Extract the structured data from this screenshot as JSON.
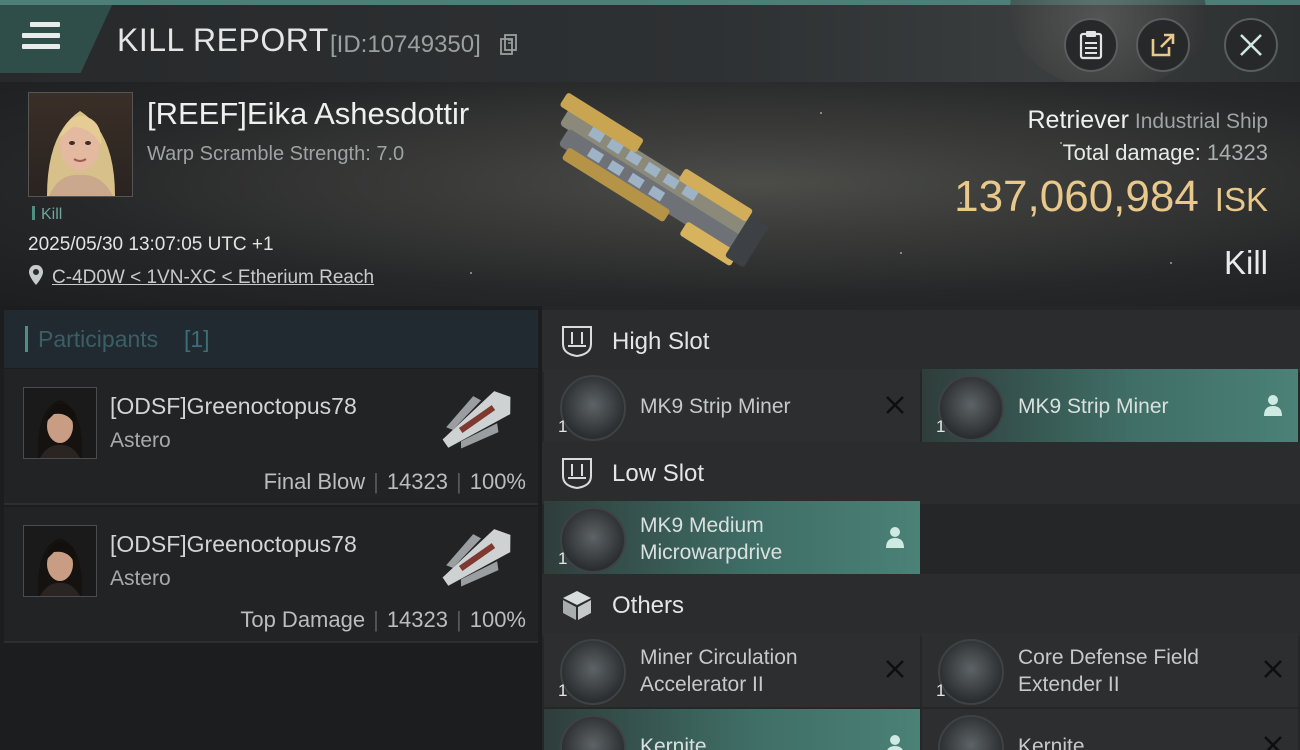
{
  "header": {
    "title": "KILL REPORT",
    "report_id": "[ID:10749350]"
  },
  "victim": {
    "name": "[REEF]Eika Ashesdottir",
    "warp_scramble": "Warp Scramble Strength: 7.0",
    "tag": "Kill",
    "datetime": "2025/05/30 13:07:05 UTC +1",
    "location": "C-4D0W < 1VN-XC < Etherium Reach"
  },
  "ship": {
    "name": "Retriever",
    "class": "Industrial Ship",
    "total_damage_label": "Total damage:",
    "total_damage": "14323",
    "value": "137,060,984",
    "currency": "ISK",
    "result": "Kill"
  },
  "participants": {
    "title": "Participants",
    "count": "[1]",
    "rows": [
      {
        "name": "[ODSF]Greenoctopus78",
        "ship": "Astero",
        "role": "Final Blow",
        "damage": "14323",
        "percent": "100%"
      },
      {
        "name": "[ODSF]Greenoctopus78",
        "ship": "Astero",
        "role": "Top Damage",
        "damage": "14323",
        "percent": "100%"
      }
    ]
  },
  "fitting": {
    "high": {
      "label": "High Slot",
      "modules": [
        {
          "name": "MK9 Strip Miner",
          "qty": "1",
          "state": "destroyed"
        },
        {
          "name": "MK9 Strip Miner",
          "qty": "1",
          "state": "dropped"
        }
      ]
    },
    "low": {
      "label": "Low Slot",
      "modules": [
        {
          "name_line1": "MK9 Medium",
          "name_line2": "Microwarpdrive",
          "qty": "1",
          "state": "dropped"
        }
      ]
    },
    "others": {
      "label": "Others",
      "modules": [
        {
          "name_line1": "Miner Circulation",
          "name_line2": "Accelerator II",
          "qty": "1",
          "state": "destroyed"
        },
        {
          "name_line1": "Core Defense Field",
          "name_line2": "Extender II",
          "qty": "1",
          "state": "destroyed"
        },
        {
          "name": "Kernite",
          "state": "dropped"
        },
        {
          "name": "Kernite",
          "state": "destroyed"
        }
      ]
    }
  },
  "colors": {
    "accent": "#4d8f86",
    "isk": "#e9c98b",
    "dropped_bg": "#4b8177"
  }
}
